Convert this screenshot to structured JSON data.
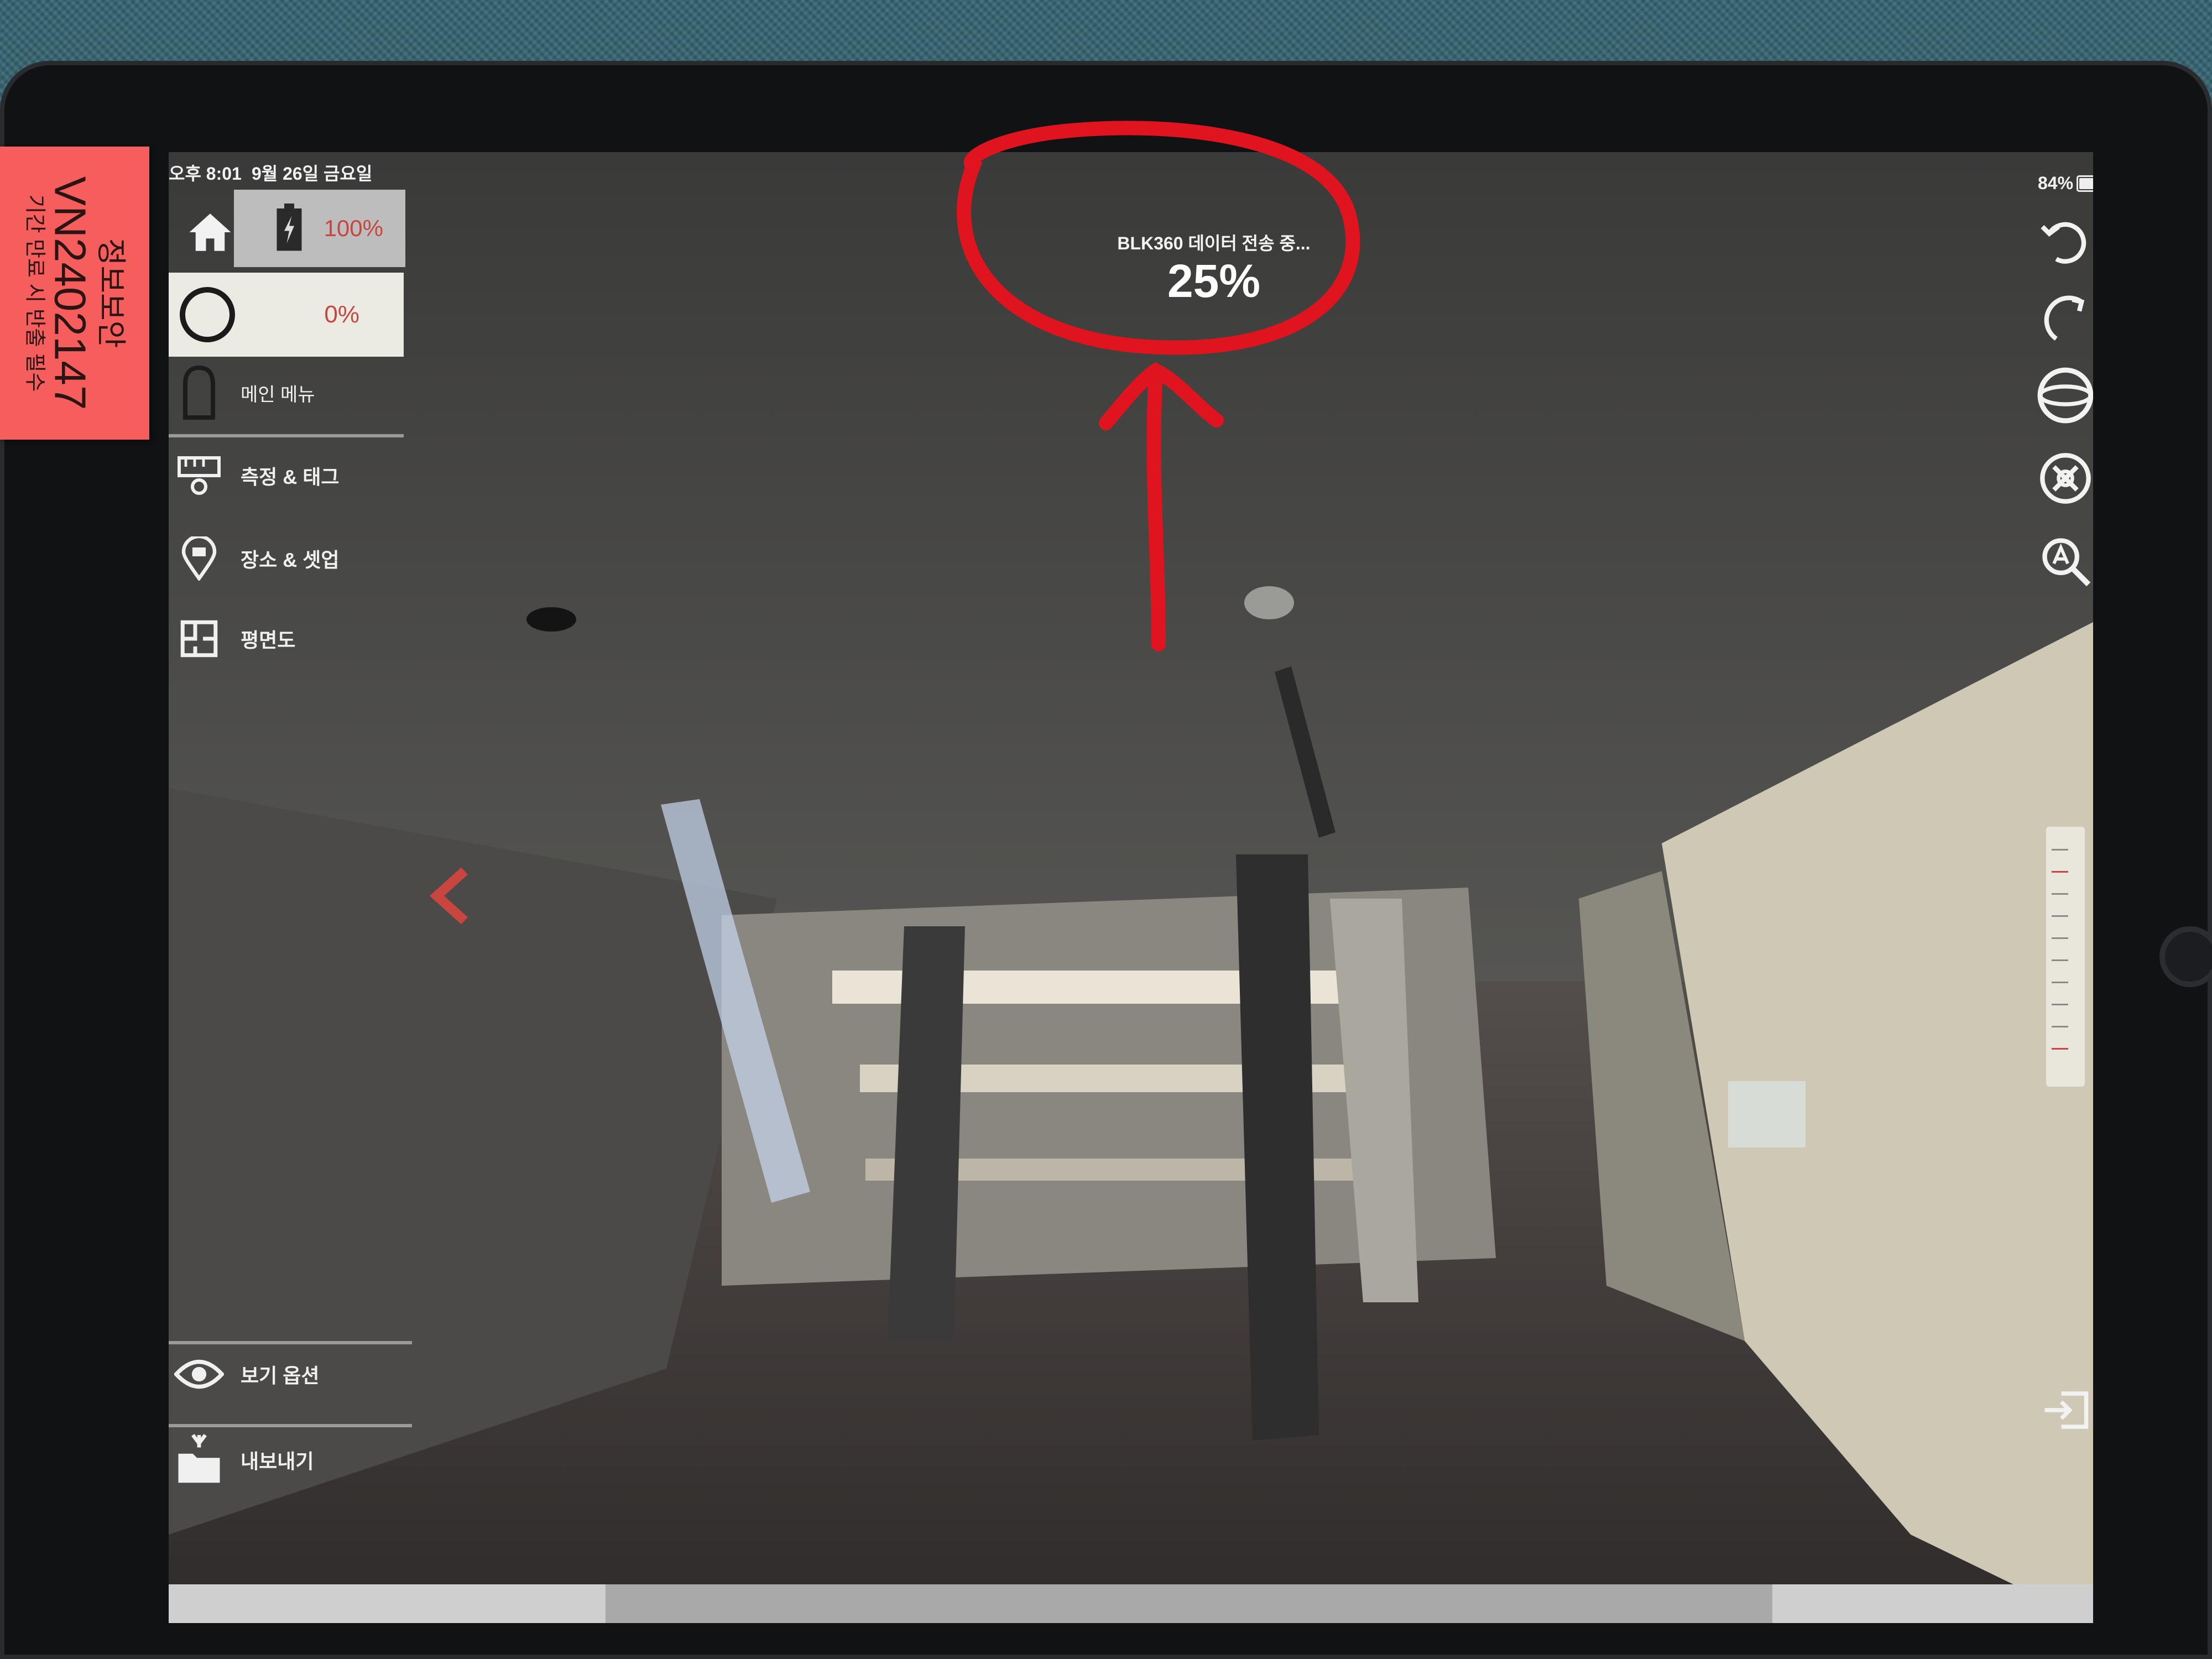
{
  "status_bar": {
    "time": "오후 8:01",
    "date": "9월 26일 금요일",
    "battery": "84%"
  },
  "left_panel": {
    "device_battery": "100%",
    "progress": "0%",
    "main_menu": "메인 메뉴",
    "measure_tag": "측정 & 태그",
    "place_setup": "장소 & 셋업",
    "floor_plan": "평면도",
    "view_options": "보기 옵션",
    "export": "내보내기"
  },
  "transfer": {
    "caption": "BLK360 데이터 전송 중...",
    "percent": "25%"
  },
  "sticker": {
    "line1": "정보보안",
    "line2": "VN2402147",
    "line3": "기간 만료 시 반출 필수"
  },
  "icons": {
    "home": "home-icon",
    "battery": "battery-charging-icon",
    "scanner": "scanner-icon",
    "measure": "measure-tag-icon",
    "place": "location-pin-icon",
    "plan": "floor-plan-icon",
    "view": "eye-icon",
    "export": "export-folder-icon",
    "undo": "undo-icon",
    "redo": "redo-icon",
    "sphere": "sphere-icon",
    "target": "target-icon",
    "zoom": "zoom-icon",
    "prev": "chevron-left-icon",
    "dock": "panel-toggle-icon"
  },
  "colors": {
    "accent_red": "#c9453f",
    "annotation_red": "#e0141e",
    "sticker": "#f55e5c"
  }
}
